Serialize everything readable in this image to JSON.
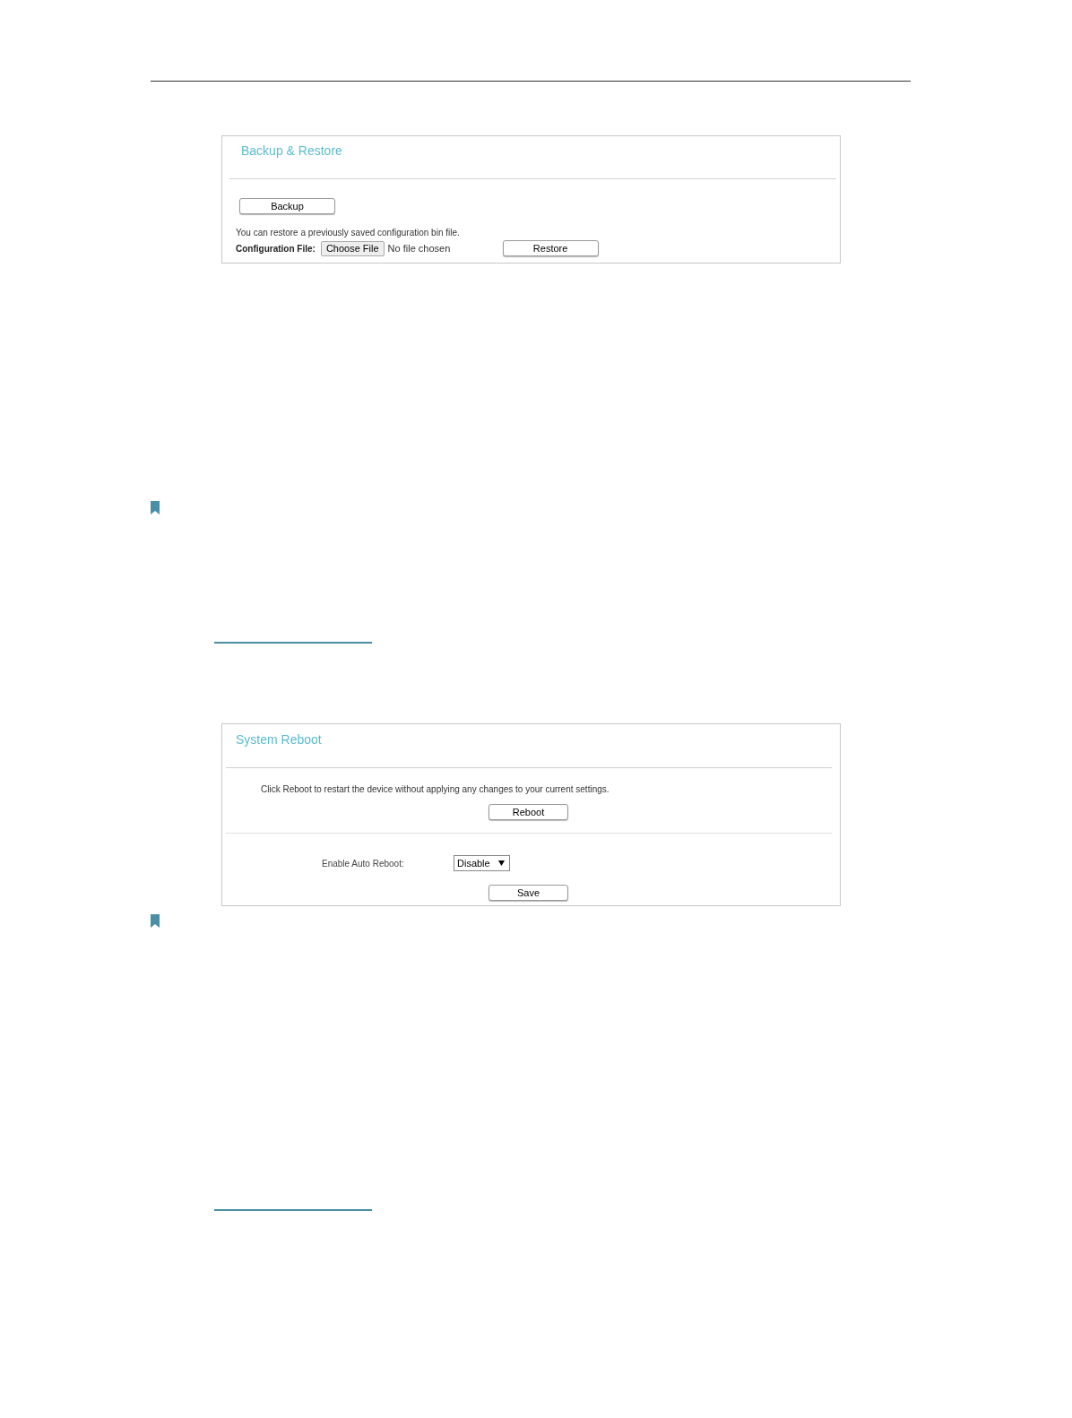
{
  "backup_restore": {
    "title": "Backup & Restore",
    "backup_button": "Backup",
    "hint": "You can restore a previously saved configuration bin file.",
    "config_label": "Configuration File:",
    "choose_button": "Choose File",
    "file_status": "No file chosen",
    "restore_button": "Restore"
  },
  "system_reboot": {
    "title": "System Reboot",
    "hint": "Click Reboot to restart the device without applying any changes to your current settings.",
    "reboot_button": "Reboot",
    "auto_label": "Enable Auto Reboot:",
    "auto_select": {
      "value": "Disable"
    },
    "save_button": "Save"
  }
}
